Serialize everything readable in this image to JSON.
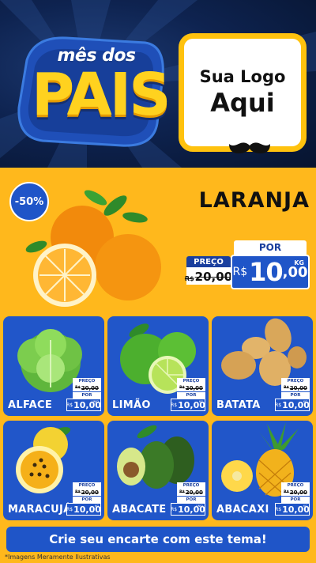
{
  "header": {
    "badge_small": "mês dos",
    "badge_big": "PAIS",
    "logo_line1": "Sua Logo",
    "logo_line2": "Aqui"
  },
  "hero": {
    "discount": "-50%",
    "product": "LARANJA",
    "preco_label": "PREÇO",
    "por_label": "POR",
    "currency": "R$",
    "old_price": "20,00",
    "new_price_int": "10",
    "new_price_dec": ",00",
    "unit": "KG"
  },
  "products": [
    {
      "name": "ALFACE",
      "preco_label": "PREÇO",
      "currency": "R$",
      "old_price": "20,00",
      "por_label": "POR",
      "new_price": "10,00",
      "unit": "UNID"
    },
    {
      "name": "LIMÃO",
      "preco_label": "PREÇO",
      "currency": "R$",
      "old_price": "20,00",
      "por_label": "POR",
      "new_price": "10,00",
      "unit": "KG"
    },
    {
      "name": "BATATA",
      "preco_label": "PREÇO",
      "currency": "R$",
      "old_price": "20,00",
      "por_label": "POR",
      "new_price": "10,00",
      "unit": "KG"
    },
    {
      "name": "MARACUJÁ",
      "preco_label": "PREÇO",
      "currency": "R$",
      "old_price": "20,00",
      "por_label": "POR",
      "new_price": "10,00",
      "unit": "KG"
    },
    {
      "name": "ABACATE",
      "preco_label": "PREÇO",
      "currency": "R$",
      "old_price": "20,00",
      "por_label": "POR",
      "new_price": "10,00",
      "unit": "UNID"
    },
    {
      "name": "ABACAXI",
      "preco_label": "PREÇO",
      "currency": "R$",
      "old_price": "20,00",
      "por_label": "POR",
      "new_price": "10,00",
      "unit": "KG"
    }
  ],
  "footer": {
    "cta": "Crie seu encarte com este tema!",
    "disclaimer": "*Imagens Meramente Ilustrativas"
  },
  "colors": {
    "yellow": "#ffb81c",
    "blue": "#1f55c8",
    "navy": "#0b1a3d"
  }
}
